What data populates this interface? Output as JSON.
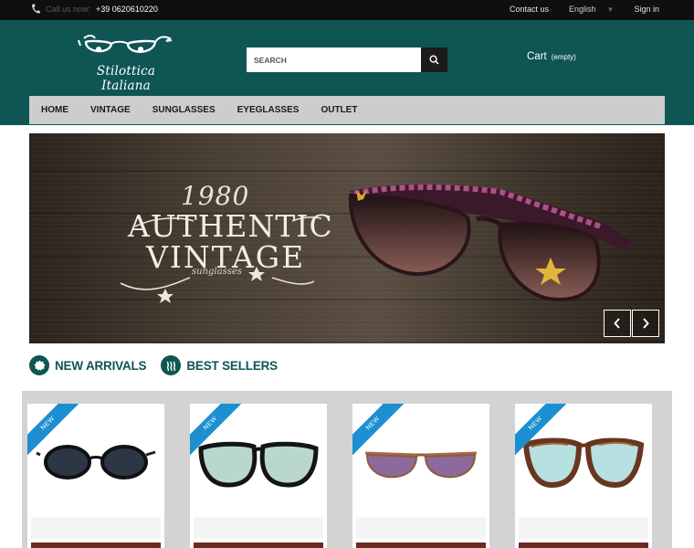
{
  "topbar": {
    "call_label": "Call us now:",
    "phone": "+39 0620610220",
    "contact": "Contact us",
    "language": "English",
    "signin": "Sign in"
  },
  "header": {
    "logo_text": "Stilottica Italiana",
    "search_placeholder": "SEARCH",
    "cart_label": "Cart",
    "cart_status": "(empty)"
  },
  "nav": {
    "items": [
      "HOME",
      "VINTAGE",
      "SUNGLASSES",
      "EYEGLASSES",
      "OUTLET"
    ]
  },
  "banner": {
    "year": "1980",
    "line1": "AUTHENTIC",
    "line2": "VINTAGE",
    "line3": "sunglasses"
  },
  "tabs": {
    "new_arrivals": "NEW ARRIVALS",
    "best_sellers": "BEST SELLERS"
  },
  "products": {
    "badge": "NEW"
  },
  "colors": {
    "brand": "#0e5553",
    "ribbon": "#1b8fd1"
  }
}
